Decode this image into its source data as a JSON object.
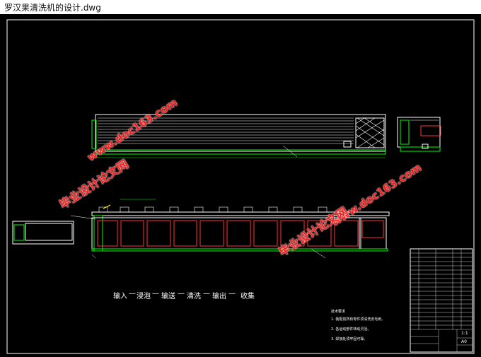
{
  "window": {
    "title": "罗汉果清洗机的设计.dwg"
  },
  "drawing": {
    "flow_steps": [
      "输入",
      "浸泡",
      "输送",
      "清洗",
      "输出",
      "收集"
    ],
    "tech_requirements": {
      "heading": "技术要求",
      "items": [
        "1. 装配前所有零件须清洗去毛刺。",
        "2. 各运动部件转动灵活。",
        "3. 焊接处须牢固可靠。"
      ]
    },
    "title_block": {
      "scale": "1:1",
      "sheet": "A0"
    }
  },
  "watermarks": [
    {
      "text": "www.doc163.com"
    },
    {
      "text": "毕业设计论文网"
    },
    {
      "text": "www.doc163.com"
    },
    {
      "text": "毕业设计论文网"
    }
  ],
  "colors": {
    "background": "#000000",
    "lines_white": "#ffffff",
    "lines_green": "#00ff00",
    "lines_red": "#ff3030",
    "lines_yellow": "#ffff00",
    "watermark": "#ff1a1a"
  }
}
